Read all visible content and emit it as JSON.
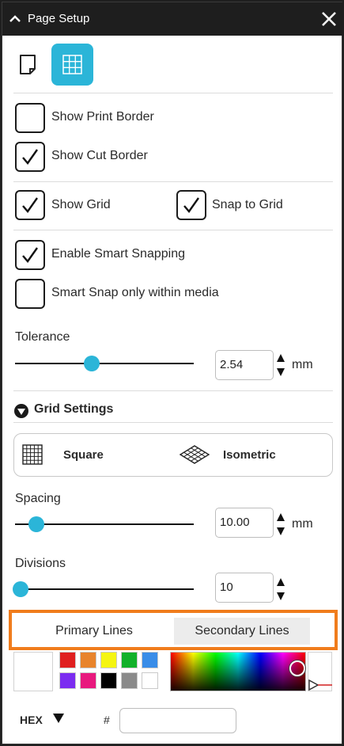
{
  "window": {
    "title": "Page Setup"
  },
  "icons": {
    "collapse": "chevron-up-icon",
    "close": "close-icon",
    "page": "page-icon",
    "grid": "grid-icon",
    "square": "square-grid-icon",
    "isometric": "isometric-grid-icon",
    "section": "triangle-down-icon",
    "hex_dropdown": "triangle-down-icon"
  },
  "colors": {
    "accent": "#2bb5d8",
    "highlight": "#f07c1c",
    "titlebar": "#1e1e1e"
  },
  "checkboxes": {
    "show_print_border": {
      "label": "Show Print Border",
      "checked": false
    },
    "show_cut_border": {
      "label": "Show Cut Border",
      "checked": true
    },
    "show_grid": {
      "label": "Show Grid",
      "checked": true
    },
    "snap_to_grid": {
      "label": "Snap to Grid",
      "checked": true
    },
    "smart_snapping": {
      "label": "Enable Smart Snapping",
      "checked": true
    },
    "smart_snap_media": {
      "label": "Smart Snap only within media",
      "checked": false
    }
  },
  "tolerance": {
    "label": "Tolerance",
    "value": "2.54",
    "unit": "mm",
    "slider_fraction": 0.43
  },
  "grid_settings": {
    "heading": "Grid Settings",
    "square_label": "Square",
    "isometric_label": "Isometric",
    "spacing": {
      "label": "Spacing",
      "value": "10.00",
      "unit": "mm",
      "slider_fraction": 0.12
    },
    "divisions": {
      "label": "Divisions",
      "value": "10",
      "slider_fraction": 0.03
    }
  },
  "line_tabs": {
    "primary": "Primary Lines",
    "secondary": "Secondary Lines",
    "active": "primary"
  },
  "swatches": [
    "#e02020",
    "#e8842c",
    "#f5f511",
    "#12b12a",
    "#3a8de8",
    "#7b2cf0",
    "#e8197e",
    "#000000",
    "#8a8a8a",
    "#ffffff"
  ],
  "hex": {
    "label": "HEX",
    "hash": "#",
    "value": ""
  }
}
